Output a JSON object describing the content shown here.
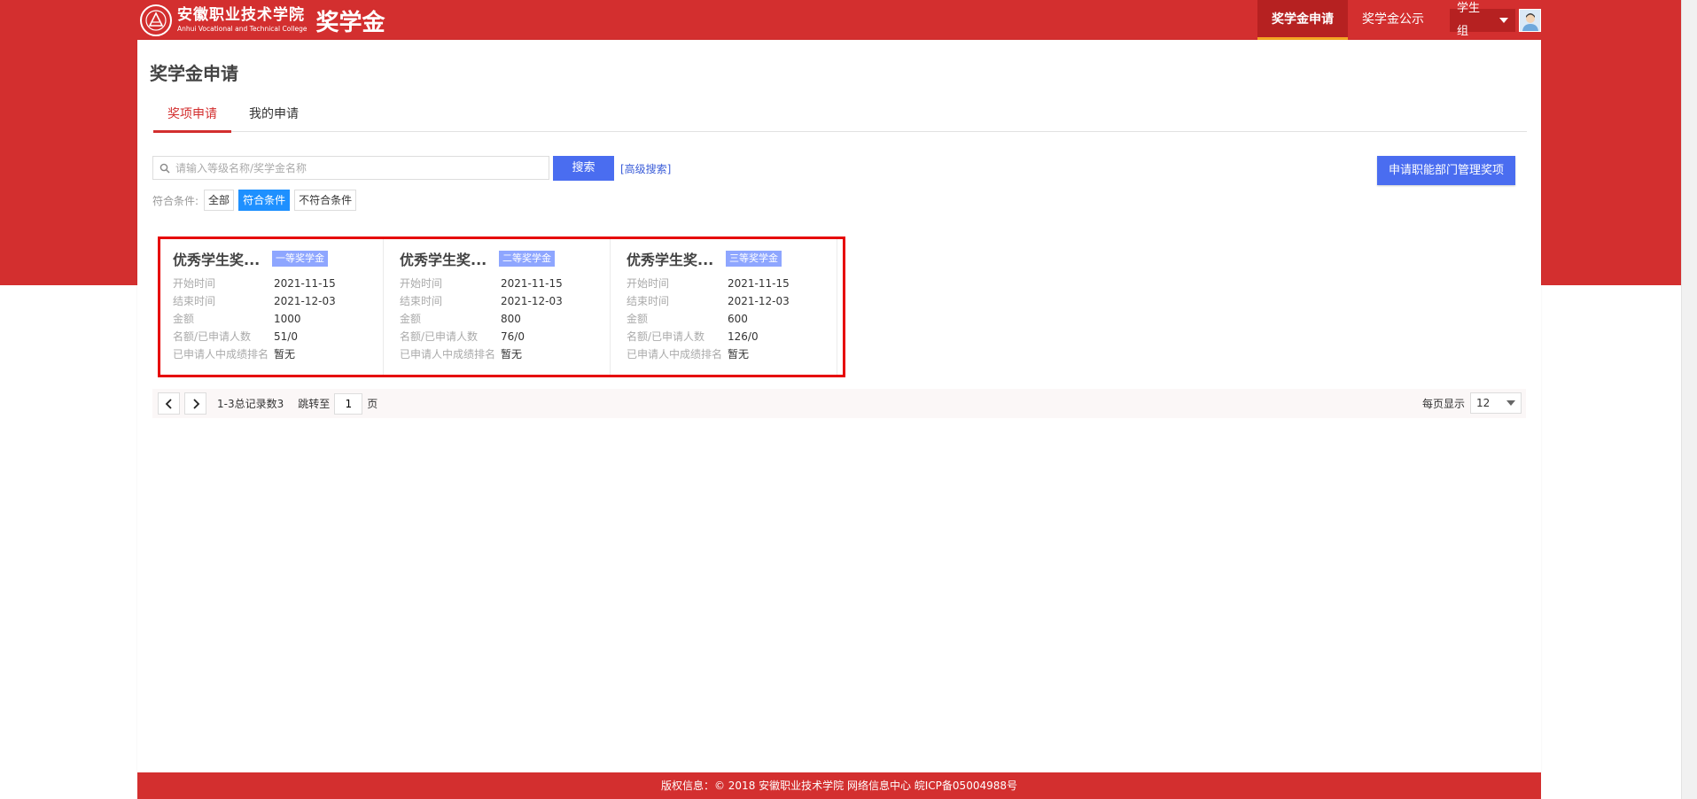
{
  "header": {
    "logo_cn": "安徽职业技术学院",
    "logo_en": "Anhui Vocational and Technical College",
    "app_title": "奖学金",
    "nav": [
      {
        "label": "奖学金申请",
        "active": true
      },
      {
        "label": "奖学金公示",
        "active": false
      }
    ],
    "user_role": "学生组"
  },
  "page": {
    "title": "奖学金申请",
    "tabs": [
      {
        "label": "奖项申请",
        "active": true
      },
      {
        "label": "我的申请",
        "active": false
      }
    ]
  },
  "search": {
    "placeholder": "请输入等级名称/奖学金名称",
    "button": "搜索",
    "advanced": "[高级搜索]"
  },
  "manage_button": "申请职能部门管理奖项",
  "filter": {
    "label": "符合条件:",
    "options": [
      {
        "label": "全部",
        "active": false
      },
      {
        "label": "符合条件",
        "active": true
      },
      {
        "label": "不符合条件",
        "active": false
      }
    ]
  },
  "card_labels": {
    "start": "开始时间",
    "end": "结束时间",
    "amount": "金额",
    "quota": "名额/已申请人数",
    "rank": "已申请人中成绩排名"
  },
  "cards": [
    {
      "title": "优秀学生奖...",
      "badge": "一等奖学金",
      "start": "2021-11-15",
      "end": "2021-12-03",
      "amount": "1000",
      "quota": "51/0",
      "rank": "暂无"
    },
    {
      "title": "优秀学生奖...",
      "badge": "二等奖学金",
      "start": "2021-11-15",
      "end": "2021-12-03",
      "amount": "800",
      "quota": "76/0",
      "rank": "暂无"
    },
    {
      "title": "优秀学生奖...",
      "badge": "三等奖学金",
      "start": "2021-11-15",
      "end": "2021-12-03",
      "amount": "600",
      "quota": "126/0",
      "rank": "暂无"
    }
  ],
  "pager": {
    "info": "1-3总记录数3",
    "jump_label": "跳转至",
    "page": "1",
    "page_unit": "页",
    "size_label": "每页显示",
    "size": "12"
  },
  "footer": "版权信息：© 2018 安徽职业技术学院 网络信息中心 皖ICP备05004988号",
  "colors": {
    "brand_red": "#d32f2f",
    "primary_blue": "#4a6df0",
    "badge_blue": "#8ea6ff",
    "active_chip": "#1e90ff",
    "highlight_box": "#e60000"
  }
}
